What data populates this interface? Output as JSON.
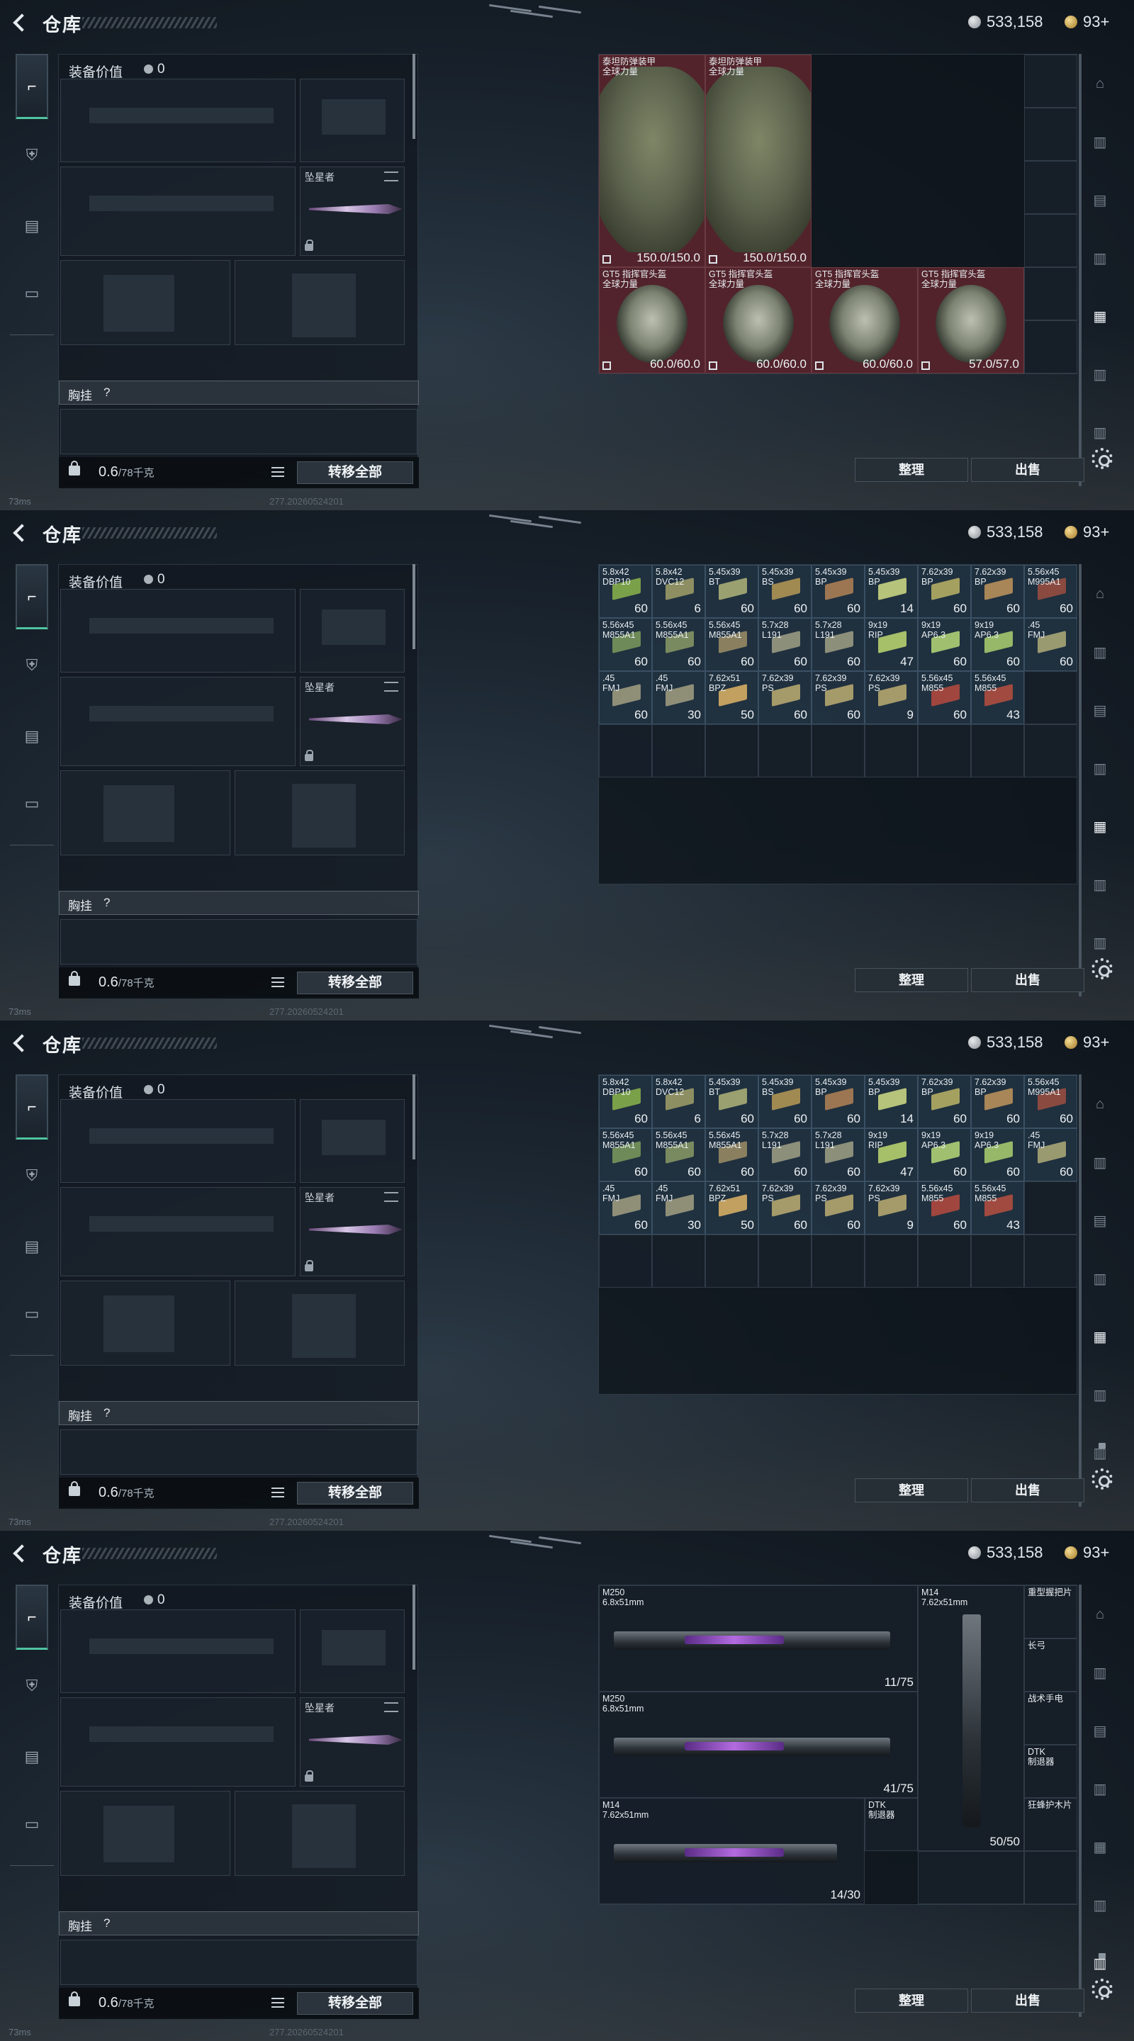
{
  "header": {
    "title": "仓库",
    "silver": "533,158",
    "gold": "93+"
  },
  "loadout": {
    "value_label": "装备价值",
    "value": "0",
    "melee_name": "坠星者",
    "vest_label": "胸挂",
    "vest_help": "?",
    "weight": "0.6",
    "weight_max": "/78千克",
    "transfer_label": "转移全部"
  },
  "status": {
    "ping": "73ms",
    "build": "277.20260524201"
  },
  "actions": {
    "sort": "整理",
    "sell": "出售"
  },
  "frames": [
    {
      "kind": "armor",
      "armors": [
        {
          "name": "泰坦防弹装甲\n全球力量",
          "durability": "150.0/150.0"
        },
        {
          "name": "泰坦防弹装甲\n全球力量",
          "durability": "150.0/150.0"
        }
      ],
      "helmets": [
        {
          "name": "GT5 指挥官头盔\n全球力量",
          "durability": "60.0/60.0"
        },
        {
          "name": "GT5 指挥官头盔\n全球力量",
          "durability": "60.0/60.0"
        },
        {
          "name": "GT5 指挥官头盔\n全球力量",
          "durability": "60.0/60.0"
        },
        {
          "name": "GT5 指挥官头盔\n全球力量",
          "durability": "57.0/57.0"
        }
      ]
    },
    {
      "kind": "ammo",
      "ammo": [
        {
          "name": "5.8x42\nDBP10",
          "count": "60",
          "color": "#7aa04a"
        },
        {
          "name": "5.8x42\nDVC12",
          "count": "6",
          "color": "#8d8f62"
        },
        {
          "name": "5.45x39\nBT",
          "count": "60",
          "color": "#9aa070"
        },
        {
          "name": "5.45x39\nBS",
          "count": "60",
          "color": "#a08a52"
        },
        {
          "name": "5.45x39\nBP",
          "count": "60",
          "color": "#9c7652"
        },
        {
          "name": "5.45x39\nBP",
          "count": "14",
          "color": "#b6c37a"
        },
        {
          "name": "7.62x39\nBP",
          "count": "60",
          "color": "#a4a060"
        },
        {
          "name": "7.62x39\nBP",
          "count": "60",
          "color": "#a88658"
        },
        {
          "name": "5.56x45\nM995A1",
          "count": "60",
          "color": "#8a4a40"
        },
        {
          "name": "5.56x45\nM855A1",
          "count": "60",
          "color": "#6e8a58"
        },
        {
          "name": "5.56x45\nM855A1",
          "count": "60",
          "color": "#7a8a60"
        },
        {
          "name": "5.56x45\nM855A1",
          "count": "60",
          "color": "#8a8060"
        },
        {
          "name": "5.7x28\nL191",
          "count": "60",
          "color": "#8c8f7a"
        },
        {
          "name": "5.7x28\nL191",
          "count": "60",
          "color": "#8c8f7a"
        },
        {
          "name": "9x19\nRIP",
          "count": "47",
          "color": "#a6c06a"
        },
        {
          "name": "9x19\nAP6.3",
          "count": "60",
          "color": "#a0c070"
        },
        {
          "name": "9x19\nAP6.3",
          "count": "60",
          "color": "#96b868"
        },
        {
          "name": ".45\nFMJ",
          "count": "60",
          "color": "#9a9a70"
        },
        {
          "name": ".45\nFMJ",
          "count": "60",
          "color": "#8f8f78"
        },
        {
          "name": ".45\nFMJ",
          "count": "30",
          "color": "#8f8f78"
        },
        {
          "name": "7.62x51\nBPZ",
          "count": "50",
          "color": "#c2a060"
        },
        {
          "name": "7.62x39\nPS",
          "count": "60",
          "color": "#a59a6a"
        },
        {
          "name": "7.62x39\nPS",
          "count": "60",
          "color": "#a59a6a"
        },
        {
          "name": "7.62x39\nPS",
          "count": "9",
          "color": "#a59a6a"
        },
        {
          "name": "5.56x45\nM855",
          "count": "60",
          "color": "#a0463e"
        },
        {
          "name": "5.56x45\nM855",
          "count": "43",
          "color": "#a04a40"
        }
      ]
    },
    {
      "kind": "ammo_copy"
    },
    {
      "kind": "weapons",
      "weapons": [
        {
          "name": "M250\n6.8x51mm",
          "ammo": "11/75"
        },
        {
          "name": "M250\n6.8x51mm",
          "ammo": "41/75"
        },
        {
          "name": "M14\n7.62x51mm",
          "ammo": "14/30"
        }
      ],
      "tall_weapon": {
        "name": "M14\n7.62x51mm",
        "ammo": "50/50"
      },
      "small": [
        {
          "name": "DTK\n制退器"
        },
        {
          "name": "重型握把片"
        },
        {
          "name": "长弓"
        },
        {
          "name": "战术手电"
        },
        {
          "name": "DTK\n制退器"
        },
        {
          "name": "狂蜂护木片"
        }
      ]
    }
  ]
}
